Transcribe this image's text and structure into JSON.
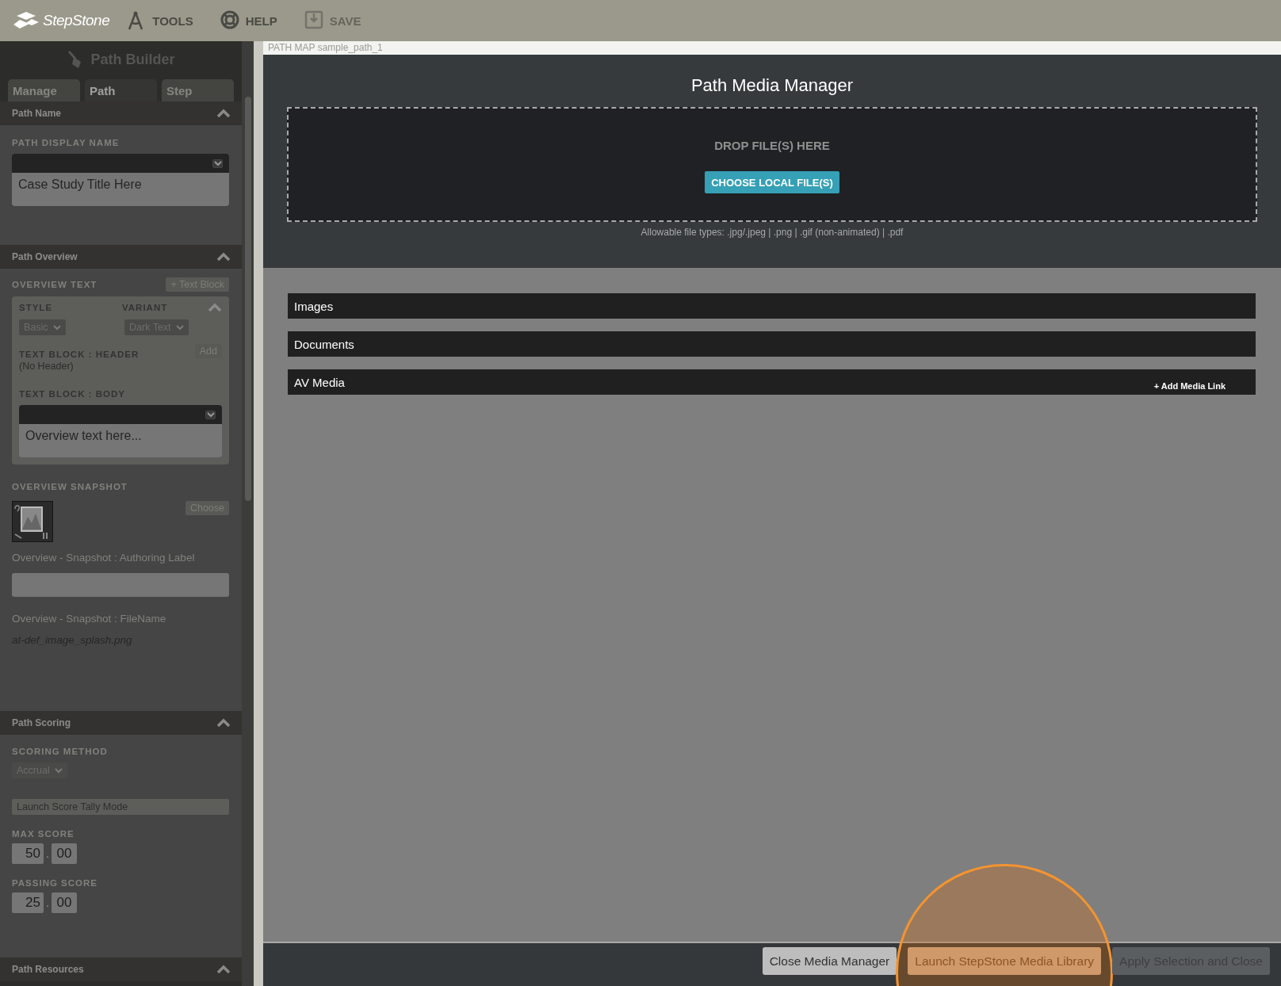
{
  "topbar": {
    "logo": "StepStone",
    "menu": [
      {
        "label": "TOOLS",
        "disabled": false
      },
      {
        "label": "HELP",
        "disabled": false
      },
      {
        "label": "SAVE",
        "disabled": true
      }
    ]
  },
  "sidebar": {
    "title": "Path Builder",
    "tabs": [
      {
        "label": "Manage",
        "selected": false
      },
      {
        "label": "Path",
        "selected": true
      },
      {
        "label": "Step",
        "selected": false
      }
    ],
    "path_name": {
      "header": "Path Name",
      "expanded": true,
      "field_label": "PATH DISPLAY NAME",
      "editor_value": "Case Study Title Here"
    },
    "path_overview": {
      "header": "Path Overview",
      "expanded": true,
      "overview_label": "OVERVIEW TEXT",
      "add_block_button": "+ Text Block",
      "card_expanded": true,
      "style_label": "STYLE",
      "style_value": "Basic",
      "variant_label": "VARIANT",
      "variant_value": "Dark Text",
      "header_label": "TEXT BLOCK : HEADER",
      "header_value": "(No Header)",
      "add_button": "Add",
      "body_label": "TEXT BLOCK : BODY",
      "body_value": "Overview text here...",
      "snapshot_label": "OVERVIEW SNAPSHOT",
      "choose_button": "Choose",
      "authoring_label": "Overview - Snapshot : Authoring Label",
      "filename_label": "Overview - Snapshot : FileName",
      "filename": "at-def_image_splash.png"
    },
    "path_scoring": {
      "header": "Path Scoring",
      "expanded": true,
      "method_label": "SCORING METHOD",
      "method_value": "Accrual",
      "tally_button": "Launch Score Tally Mode",
      "max_label": "MAX SCORE",
      "max_whole": "50",
      "max_separator": ".",
      "max_fraction": "00",
      "pass_label": "PASSING SCORE",
      "pass_whole": "25",
      "pass_separator": ".",
      "pass_fraction": "00"
    },
    "path_resources": {
      "header": "Path Resources",
      "expanded": true
    }
  },
  "breadcrumb": "PATH MAP sample_path_1",
  "modal": {
    "title": "Path Media Manager",
    "drop_text": "DROP FILE(S) HERE",
    "choose_button": "CHOOSE LOCAL FILE(S)",
    "file_types": "Allowable file types: .jpg/.jpeg | .png | .gif (non-animated) | .pdf",
    "categories": [
      {
        "label": "Images"
      },
      {
        "label": "Documents"
      },
      {
        "label": "AV Media",
        "action": "+ Add Media Link"
      }
    ],
    "buttons": [
      {
        "label": "Close Media Manager",
        "kind": "secondary",
        "highlighted": false
      },
      {
        "label": "Launch StepStone Media Library",
        "kind": "accent",
        "highlighted": true
      },
      {
        "label": "Apply Selection and Close",
        "kind": "disabled",
        "highlighted": false
      }
    ]
  }
}
